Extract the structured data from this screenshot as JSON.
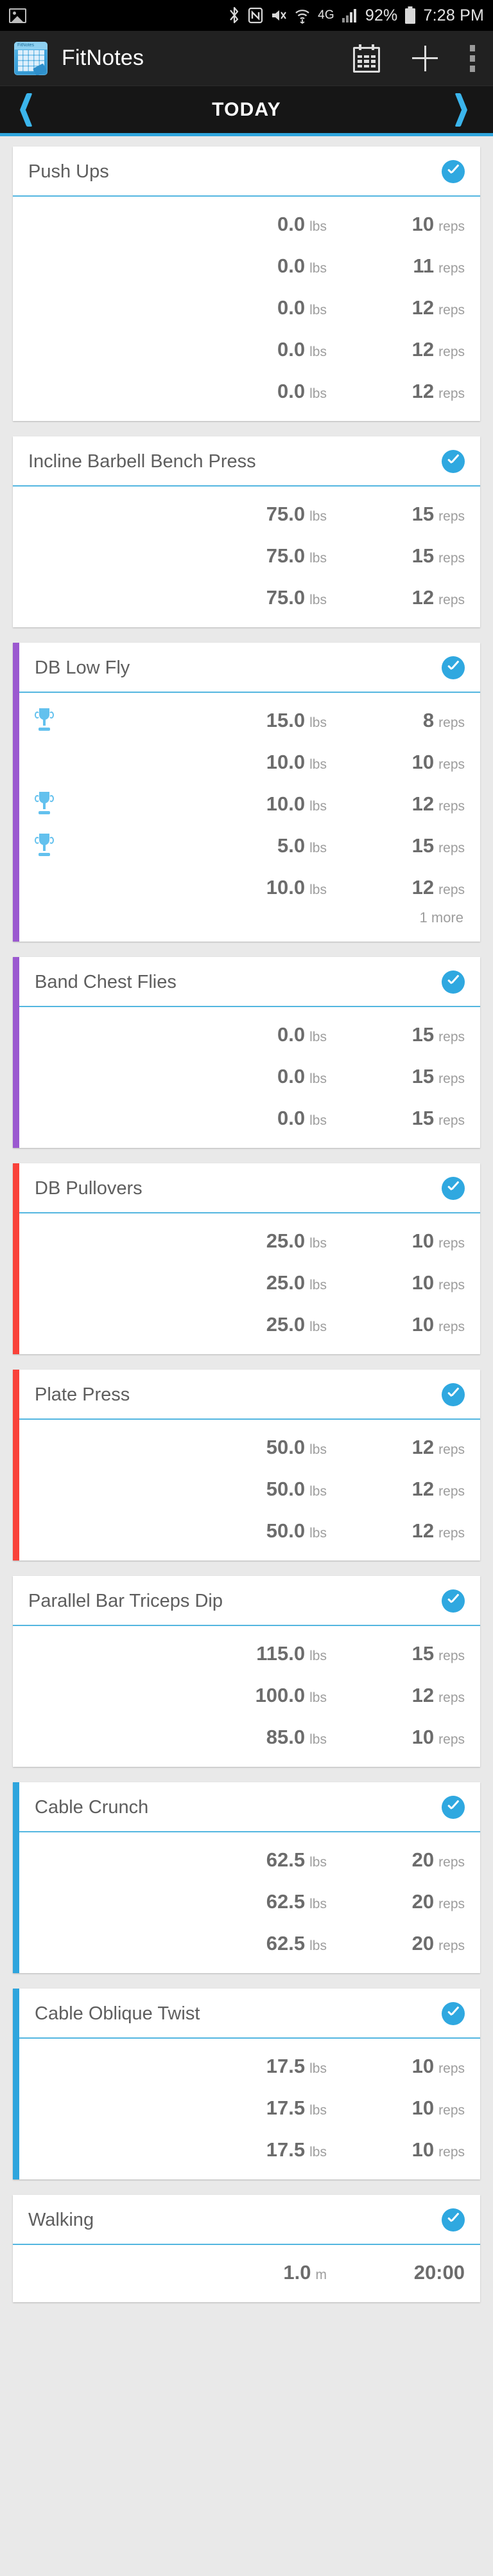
{
  "status_bar": {
    "icons": [
      "photo-icon",
      "bluetooth-icon",
      "nfc-icon",
      "mute-icon",
      "wifi-icon",
      "4g-icon",
      "signal-icon"
    ],
    "bluetooth": "✶",
    "nfc": "N",
    "mute": "✕",
    "network": "4G",
    "battery_percent": "92%",
    "time": "7:28 PM"
  },
  "app_bar": {
    "title": "FitNotes",
    "logo_label": "FitNotes",
    "actions": [
      {
        "name": "calendar-button",
        "label": "Calendar"
      },
      {
        "name": "add-button",
        "label": "Add"
      },
      {
        "name": "overflow-button",
        "label": "More options"
      }
    ]
  },
  "date_bar": {
    "prev_label": "Previous day",
    "label": "TODAY",
    "next_label": "Next day"
  },
  "colors": {
    "accent_blue": "#2fa8e0",
    "accent_purple": "#9b59d0",
    "accent_red": "#f9423a",
    "accent_cyan": "#2fa5dd",
    "page_bg": "#e9e9e9",
    "card_bg": "#ffffff",
    "text_primary": "#5e5e5e",
    "text_value": "#6c6c6c",
    "text_unit": "#9d9d9d"
  },
  "workouts": [
    {
      "name": "Push Ups",
      "accent": "none",
      "completed": true,
      "sets": [
        {
          "weight": "0.0",
          "weight_unit": "lbs",
          "reps": "10",
          "reps_unit": "reps",
          "pr": false
        },
        {
          "weight": "0.0",
          "weight_unit": "lbs",
          "reps": "11",
          "reps_unit": "reps",
          "pr": false
        },
        {
          "weight": "0.0",
          "weight_unit": "lbs",
          "reps": "12",
          "reps_unit": "reps",
          "pr": false
        },
        {
          "weight": "0.0",
          "weight_unit": "lbs",
          "reps": "12",
          "reps_unit": "reps",
          "pr": false
        },
        {
          "weight": "0.0",
          "weight_unit": "lbs",
          "reps": "12",
          "reps_unit": "reps",
          "pr": false
        }
      ],
      "more": ""
    },
    {
      "name": "Incline Barbell Bench Press",
      "accent": "none",
      "completed": true,
      "sets": [
        {
          "weight": "75.0",
          "weight_unit": "lbs",
          "reps": "15",
          "reps_unit": "reps",
          "pr": false
        },
        {
          "weight": "75.0",
          "weight_unit": "lbs",
          "reps": "15",
          "reps_unit": "reps",
          "pr": false
        },
        {
          "weight": "75.0",
          "weight_unit": "lbs",
          "reps": "12",
          "reps_unit": "reps",
          "pr": false
        }
      ],
      "more": ""
    },
    {
      "name": "DB Low Fly",
      "accent": "#9b59d0",
      "completed": true,
      "sets": [
        {
          "weight": "15.0",
          "weight_unit": "lbs",
          "reps": "8",
          "reps_unit": "reps",
          "pr": true
        },
        {
          "weight": "10.0",
          "weight_unit": "lbs",
          "reps": "10",
          "reps_unit": "reps",
          "pr": false
        },
        {
          "weight": "10.0",
          "weight_unit": "lbs",
          "reps": "12",
          "reps_unit": "reps",
          "pr": true
        },
        {
          "weight": "5.0",
          "weight_unit": "lbs",
          "reps": "15",
          "reps_unit": "reps",
          "pr": true
        },
        {
          "weight": "10.0",
          "weight_unit": "lbs",
          "reps": "12",
          "reps_unit": "reps",
          "pr": false
        }
      ],
      "more": "1 more"
    },
    {
      "name": "Band Chest Flies",
      "accent": "#9b59d0",
      "completed": true,
      "sets": [
        {
          "weight": "0.0",
          "weight_unit": "lbs",
          "reps": "15",
          "reps_unit": "reps",
          "pr": false
        },
        {
          "weight": "0.0",
          "weight_unit": "lbs",
          "reps": "15",
          "reps_unit": "reps",
          "pr": false
        },
        {
          "weight": "0.0",
          "weight_unit": "lbs",
          "reps": "15",
          "reps_unit": "reps",
          "pr": false
        }
      ],
      "more": ""
    },
    {
      "name": "DB Pullovers",
      "accent": "#f9423a",
      "completed": true,
      "sets": [
        {
          "weight": "25.0",
          "weight_unit": "lbs",
          "reps": "10",
          "reps_unit": "reps",
          "pr": false
        },
        {
          "weight": "25.0",
          "weight_unit": "lbs",
          "reps": "10",
          "reps_unit": "reps",
          "pr": false
        },
        {
          "weight": "25.0",
          "weight_unit": "lbs",
          "reps": "10",
          "reps_unit": "reps",
          "pr": false
        }
      ],
      "more": ""
    },
    {
      "name": "Plate Press",
      "accent": "#f9423a",
      "completed": true,
      "sets": [
        {
          "weight": "50.0",
          "weight_unit": "lbs",
          "reps": "12",
          "reps_unit": "reps",
          "pr": false
        },
        {
          "weight": "50.0",
          "weight_unit": "lbs",
          "reps": "12",
          "reps_unit": "reps",
          "pr": false
        },
        {
          "weight": "50.0",
          "weight_unit": "lbs",
          "reps": "12",
          "reps_unit": "reps",
          "pr": false
        }
      ],
      "more": ""
    },
    {
      "name": "Parallel Bar Triceps Dip",
      "accent": "none",
      "completed": true,
      "sets": [
        {
          "weight": "115.0",
          "weight_unit": "lbs",
          "reps": "15",
          "reps_unit": "reps",
          "pr": false
        },
        {
          "weight": "100.0",
          "weight_unit": "lbs",
          "reps": "12",
          "reps_unit": "reps",
          "pr": false
        },
        {
          "weight": "85.0",
          "weight_unit": "lbs",
          "reps": "10",
          "reps_unit": "reps",
          "pr": false
        }
      ],
      "more": ""
    },
    {
      "name": "Cable Crunch",
      "accent": "#2fa5dd",
      "completed": true,
      "sets": [
        {
          "weight": "62.5",
          "weight_unit": "lbs",
          "reps": "20",
          "reps_unit": "reps",
          "pr": false
        },
        {
          "weight": "62.5",
          "weight_unit": "lbs",
          "reps": "20",
          "reps_unit": "reps",
          "pr": false
        },
        {
          "weight": "62.5",
          "weight_unit": "lbs",
          "reps": "20",
          "reps_unit": "reps",
          "pr": false
        }
      ],
      "more": ""
    },
    {
      "name": "Cable Oblique Twist",
      "accent": "#2fa5dd",
      "completed": true,
      "sets": [
        {
          "weight": "17.5",
          "weight_unit": "lbs",
          "reps": "10",
          "reps_unit": "reps",
          "pr": false
        },
        {
          "weight": "17.5",
          "weight_unit": "lbs",
          "reps": "10",
          "reps_unit": "reps",
          "pr": false
        },
        {
          "weight": "17.5",
          "weight_unit": "lbs",
          "reps": "10",
          "reps_unit": "reps",
          "pr": false
        }
      ],
      "more": ""
    },
    {
      "name": "Walking",
      "accent": "none",
      "completed": true,
      "sets": [
        {
          "weight": "1.0",
          "weight_unit": "m",
          "reps": "20:00",
          "reps_unit": "",
          "pr": false
        }
      ],
      "more": ""
    }
  ]
}
